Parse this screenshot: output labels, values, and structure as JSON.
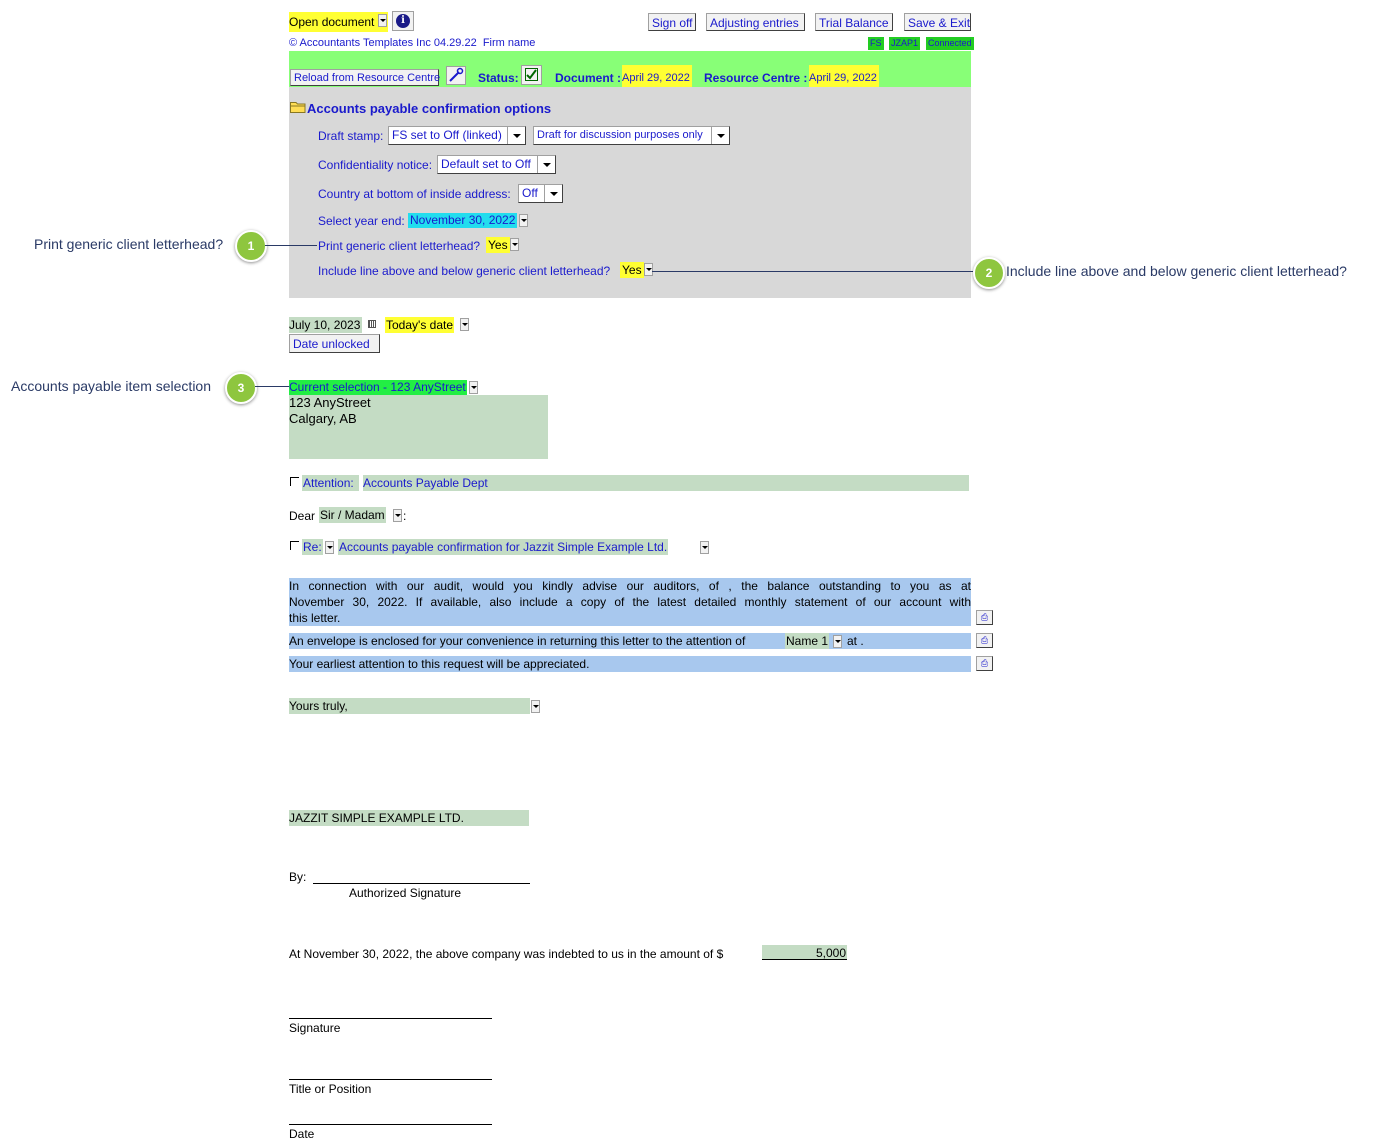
{
  "toolbar": {
    "open_document": "Open document",
    "sign_off": "Sign off",
    "adjusting_entries": "Adjusting entries",
    "trial_balance": "Trial Balance",
    "save_exit": "Save & Exit",
    "copyright": "© Accountants Templates Inc 04.29.22",
    "firm_name": "Firm name",
    "tags": [
      "FS",
      "JZAP1",
      "Connected"
    ]
  },
  "status_bar": {
    "reload": "Reload from Resource Centre",
    "status_label": "Status:",
    "document_label": "Document :",
    "document_date": "April 29, 2022",
    "resource_label": "Resource Centre :",
    "resource_date": "April 29, 2022"
  },
  "options": {
    "title": "Accounts payable confirmation options",
    "draft_stamp_label": "Draft stamp:",
    "draft_stamp_value": "FS set to Off (linked)",
    "draft_text_value": "Draft for discussion purposes only",
    "confidentiality_label": "Confidentiality notice:",
    "confidentiality_value": "Default set to Off",
    "country_label": "Country at bottom of inside address:",
    "country_value": "Off",
    "year_end_label": "Select year end:",
    "year_end_value": "November 30, 2022",
    "letterhead_label": "Print generic client letterhead?",
    "letterhead_value": "Yes",
    "line_label": "Include line above and below generic client letterhead?",
    "line_value": "Yes"
  },
  "callouts": [
    {
      "num": "1",
      "label": "Print generic client letterhead?"
    },
    {
      "num": "2",
      "label": "Include line above and below generic client letterhead?"
    },
    {
      "num": "3",
      "label": "Accounts payable item selection"
    }
  ],
  "letter": {
    "date": "July 10, 2023",
    "date_option": "Today's date",
    "date_lock": "Date unlocked",
    "selection": "Current selection - 123 AnyStreet",
    "address_line1": "123 AnyStreet",
    "address_line2": "Calgary, AB",
    "attention_label": "Attention:",
    "attention_value": "Accounts Payable Dept",
    "dear": "Dear",
    "salutation": "Sir / Madam",
    "salutation_colon": ":",
    "re_label": "Re:",
    "re_value": "Accounts payable confirmation for Jazzit Simple Example Ltd.",
    "para1_line1": "In connection with our audit, would you kindly advise our auditors,   of  ,  the balance outstanding to you as at",
    "para1_line2": "November 30, 2022.  If available, also include a copy of the latest detailed monthly statement of our account with",
    "para1_line3": "this letter.",
    "para2_text": "An envelope is enclosed for your convenience in returning this letter to the attention of",
    "para2_name": "Name 1",
    "para2_at": "at        .",
    "para3": "Your earliest attention to this request will be appreciated.",
    "closing": "Yours truly,",
    "company": "JAZZIT SIMPLE EXAMPLE LTD.",
    "by": "By:",
    "authorized": "Authorized Signature",
    "indebted": "At November 30, 2022, the above company was indebted to us in the amount of  $",
    "amount": "5,000",
    "signature": "Signature",
    "title_position": "Title or Position",
    "date_label": "Date"
  }
}
